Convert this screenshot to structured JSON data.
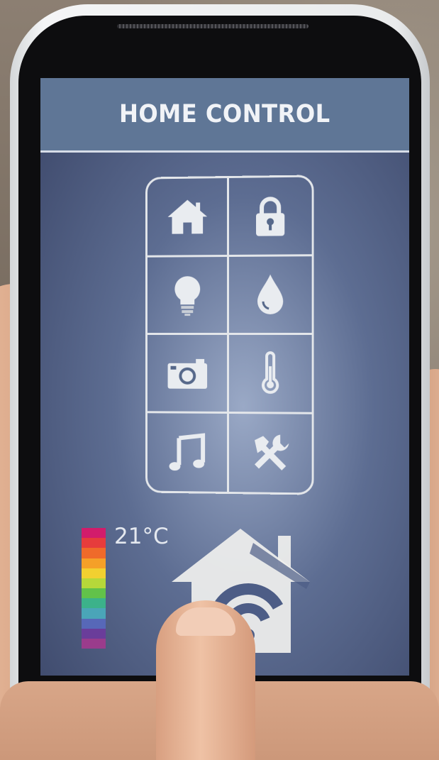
{
  "header": {
    "title": "HOME CONTROL"
  },
  "controls": [
    {
      "icon": "home-icon"
    },
    {
      "icon": "lock-icon"
    },
    {
      "icon": "light-bulb-icon"
    },
    {
      "icon": "water-drop-icon"
    },
    {
      "icon": "camera-icon"
    },
    {
      "icon": "thermometer-icon"
    },
    {
      "icon": "music-note-icon"
    },
    {
      "icon": "tools-icon"
    }
  ],
  "temperature": {
    "label": "21°C",
    "scale_colors": [
      "#d21c6b",
      "#e63c3c",
      "#ef6a2a",
      "#f5a028",
      "#f2d030",
      "#b6d83a",
      "#62c24a",
      "#3cb28a",
      "#4aa5b8",
      "#5768b8",
      "#6a3d9a",
      "#9a3c8c"
    ]
  },
  "main_button": {
    "icon": "home-wifi-icon"
  },
  "colors": {
    "title_bar": "#5f7696",
    "screen_bg": "#5d6d92",
    "line": "#e3e6ea"
  }
}
